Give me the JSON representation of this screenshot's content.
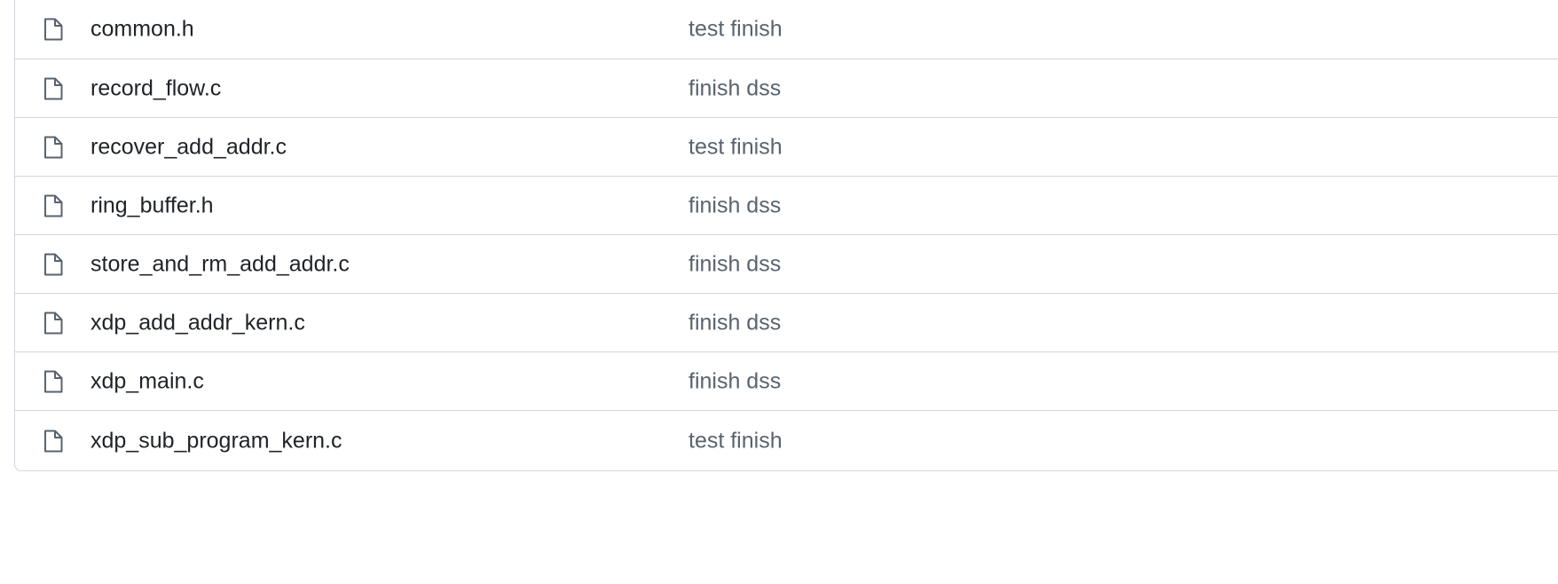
{
  "files": [
    {
      "icon": "file-icon",
      "name": "common.h",
      "message": "test finish"
    },
    {
      "icon": "file-icon",
      "name": "record_flow.c",
      "message": "finish dss"
    },
    {
      "icon": "file-icon",
      "name": "recover_add_addr.c",
      "message": "test finish"
    },
    {
      "icon": "file-icon",
      "name": "ring_buffer.h",
      "message": "finish dss"
    },
    {
      "icon": "file-icon",
      "name": "store_and_rm_add_addr.c",
      "message": "finish dss"
    },
    {
      "icon": "file-icon",
      "name": "xdp_add_addr_kern.c",
      "message": "finish dss"
    },
    {
      "icon": "file-icon",
      "name": "xdp_main.c",
      "message": "finish dss"
    },
    {
      "icon": "file-icon",
      "name": "xdp_sub_program_kern.c",
      "message": "test finish"
    }
  ],
  "colors": {
    "border": "#d0d7de",
    "file_name": "#1f2328",
    "commit_message": "#59636e",
    "icon": "#59636e"
  }
}
